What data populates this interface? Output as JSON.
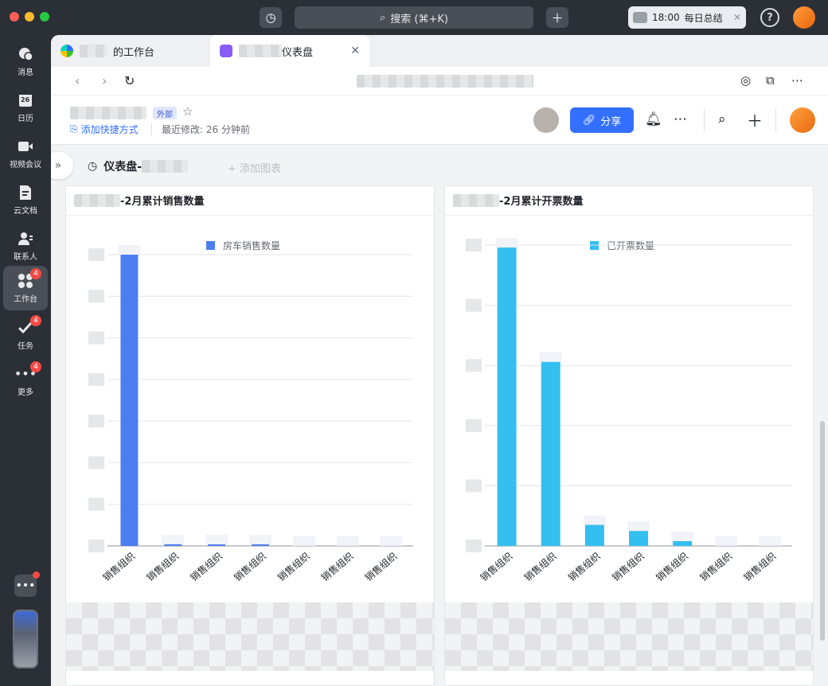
{
  "titlebar": {
    "search_label": "搜索 (⌘+K)",
    "daily_time": "18:00",
    "daily_label": "每日总结"
  },
  "nav": {
    "items": [
      {
        "label": "消息",
        "icon": "chat-icon",
        "badge": ""
      },
      {
        "label": "日历",
        "icon": "calendar-icon",
        "badge": "",
        "day": "26"
      },
      {
        "label": "视频会议",
        "icon": "video-icon",
        "badge": ""
      },
      {
        "label": "云文档",
        "icon": "doc-icon",
        "badge": ""
      },
      {
        "label": "联系人",
        "icon": "contacts-icon",
        "badge": ""
      },
      {
        "label": "工作台",
        "icon": "workplace-icon",
        "badge": "4"
      },
      {
        "label": "任务",
        "icon": "task-icon",
        "badge": "4"
      },
      {
        "label": "更多",
        "icon": "more-icon",
        "badge": "4"
      }
    ]
  },
  "tabs": [
    {
      "label": "的工作台"
    },
    {
      "label": "仪表盘"
    }
  ],
  "doc": {
    "external_tag": "外部",
    "shortcut_label": "添加快捷方式",
    "modified_label": "最近修改: 26 分钟前",
    "share_label": "分享"
  },
  "dashboard": {
    "title": "仪表盘-",
    "add_chart_label": "+ 添加图表"
  },
  "colors": {
    "accent": "#3370ff",
    "series1": "#4d7ef0",
    "series2": "#35bff0"
  },
  "chart_data": [
    {
      "type": "bar",
      "title": "-2月累计销售数量",
      "series": [
        {
          "name": "房车销售数量",
          "values": [
            7000,
            40,
            30,
            20,
            0,
            0,
            0
          ]
        }
      ],
      "categories": [
        "销售组织",
        "销售组织",
        "销售组织",
        "销售组织",
        "销售组织",
        "销售组织",
        "销售组织"
      ],
      "ylim": [
        0,
        7000
      ],
      "grid": true,
      "legend": "top-center"
    },
    {
      "type": "bar",
      "title": "-2月累计开票数量",
      "series": [
        {
          "name": "已开票数量",
          "values": [
            2480,
            1530,
            175,
            125,
            40,
            0,
            0
          ]
        }
      ],
      "categories": [
        "销售组织",
        "销售组织",
        "销售组织",
        "销售组织",
        "销售组织",
        "销售组织",
        "销售组织"
      ],
      "ylim": [
        0,
        2500
      ],
      "grid": true,
      "legend": "top-center"
    }
  ]
}
